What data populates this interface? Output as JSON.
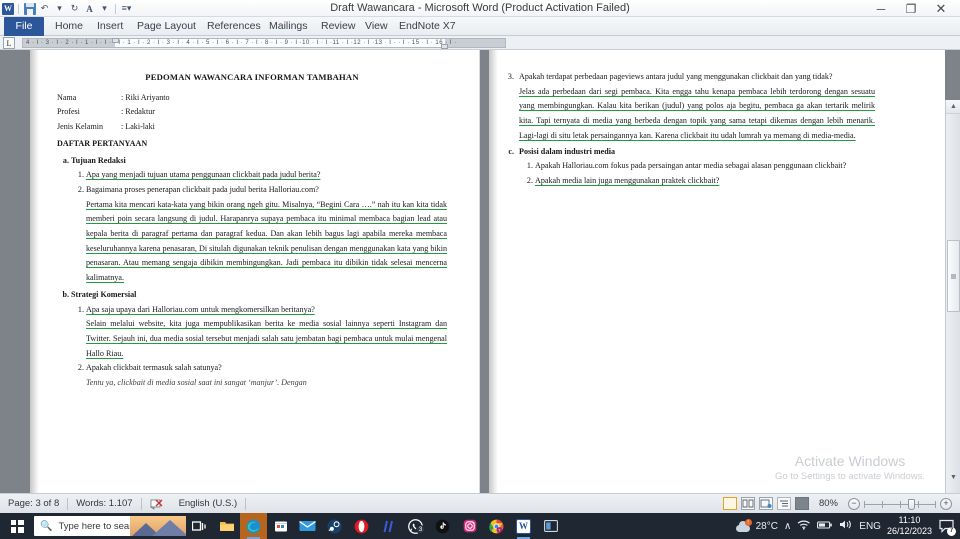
{
  "window": {
    "title": "Draft Wawancara  -  Microsoft Word (Product Activation Failed)",
    "minimize_label": "─",
    "restore_label": "❐",
    "close_label": "✕"
  },
  "quick_access": {
    "word_logo": "W",
    "items": [
      {
        "name": "save-icon",
        "label": "Save"
      },
      {
        "name": "undo-icon",
        "label": "↶"
      },
      {
        "name": "undo-dropdown-icon",
        "label": "▾"
      },
      {
        "name": "redo-icon",
        "label": "↻"
      },
      {
        "name": "font-color-icon",
        "label": "A"
      },
      {
        "name": "font-color-dropdown-icon",
        "label": "▾"
      },
      {
        "name": "customize-qat-icon",
        "label": "≡▾"
      }
    ]
  },
  "ribbon": {
    "tabs": [
      {
        "label": "File",
        "active": true
      },
      {
        "label": "Home",
        "active": false
      },
      {
        "label": "Insert",
        "active": false
      },
      {
        "label": "Page Layout",
        "active": false
      },
      {
        "label": "References",
        "active": false
      },
      {
        "label": "Mailings",
        "active": false
      },
      {
        "label": "Review",
        "active": false
      },
      {
        "label": "View",
        "active": false
      },
      {
        "label": "EndNote X7",
        "active": false
      }
    ],
    "ribbon_toggle_icon": "⌄",
    "help_icon": "?"
  },
  "ruler": {
    "tab_selector": "L",
    "marks": "4 · I · 3 · I · 2 · I · 1 · I · I · · I · 1 · I · 2 · I · 3 · I · 4 · I · 5 · I · 6 · I · 7 · I · 8 · I · 9 · I ·10 · I · I ·11 · I ·12 · I ·13 · I · · I · 15 · I · 16 · I ·"
  },
  "document": {
    "left_page": {
      "title": "PEDOMAN WAWANCARA INFORMAN TAMBAHAN",
      "meta": [
        {
          "key": "Nama",
          "value": ": Riki Ariyanto"
        },
        {
          "key": "Profesi",
          "value": ": Redaktur"
        },
        {
          "key": "Jenis Kelamin",
          "value": ": Laki-laki"
        }
      ],
      "section_heading": "DAFTAR PERTANYAAN",
      "sections": [
        {
          "label": "Tujuan Redaksi",
          "questions": [
            {
              "q": "Apa yang menjadi tujuan utama penggunaan clickbait pada judul berita?",
              "answer": ""
            },
            {
              "q": "Bagaimana proses penerapan clickbait pada judul berita Halloriau.com?",
              "answer": "Pertama kita mencari kata-kata yang bikin orang ngeh gitu. Misalnya, “Begini Cara ….” nah itu kan kita tidak memberi poin secara langsung di judul. Harapanrya supaya pembaca itu minimal membaca bagian lead atau kepala berita di paragraf pertama dan paragraf kedua. Dan akan lebih bagus lagi apabila mereka membaca keseluruhannya karena penasaran, Di situlah digunakan teknik penulisan dengan menggunakan kata yang bikin penasaran. Atau memang sengaja dibikin membingungkan. Jadi pembaca itu dibikin tidak selesai mencerna kalimatnya."
            }
          ]
        },
        {
          "label": "Strategi Komersial",
          "questions": [
            {
              "q": "Apa saja upaya dari Halloriau.com untuk mengkomersilkan beritanya?",
              "answer": "Selain melalui website, kita juga mempublikasikan berita ke media sosial lainnya seperti Instagram dan Twitter. Sejauh ini, dua media sosial tersebut menjadi salah satu jembatan bagi pembaca untuk mulai mengenal Hallo Riau."
            },
            {
              "q": "Apakah clickbait termasuk salah satunya?",
              "answer": "Tentu ya, clickbait di media sosial saat ini sangat ‘manjur’. Dengan"
            }
          ]
        }
      ]
    },
    "right_page": {
      "continued_question": {
        "number": "3.",
        "q": "Apakah terdapat perbedaan pageviews antara judul yang menggunakan clickbait dan yang tidak?",
        "answer": "Jelas ada perbedaan dari segi pembaca. Kita engga tahu kenapa pembaca lebih terdorong dengan sesuatu yang membingungkan. Kalau kita berikan (judul) yang polos aja begitu, pembaca ga akan tertarik melirik kita. Tapi ternyata di media yang berbeda dengan topik yang sama tetapi dikemas dengan lebih menarik. Lagi-lagi di situ letak persaingannya kan. Karena clickbait itu udah lumrah ya memang di media-media."
      },
      "section": {
        "label": "Posisi dalam industri media",
        "bullet": "c.",
        "questions": [
          "Apakah Halloriau.com fokus pada persaingan antar media sebagai alasan penggunaan clickbait?",
          "Apakah media lain juga menggunakan praktek clickbait?"
        ]
      }
    },
    "watermark": {
      "line1": "Activate Windows",
      "line2": "Go to Settings to activate Windows."
    }
  },
  "status_bar": {
    "page": "Page: 3 of 8",
    "words": "Words: 1.107",
    "proofing_icon": "proofing-errors-icon",
    "language": "English (U.S.)",
    "view_buttons": [
      {
        "name": "print-layout-view",
        "active": true
      },
      {
        "name": "full-screen-reading-view",
        "active": false
      },
      {
        "name": "web-layout-view",
        "active": false
      },
      {
        "name": "outline-view",
        "active": false
      },
      {
        "name": "draft-view",
        "active": false
      }
    ],
    "zoom_level": "80%",
    "zoom_out": "−",
    "zoom_in": "+"
  },
  "taskbar": {
    "start_icon": "windows-start-icon",
    "search_placeholder": "Type here to search",
    "pinned": [
      {
        "name": "task-view-icon",
        "glyph": "▣",
        "color": "#ffffff"
      },
      {
        "name": "file-explorer-icon",
        "glyph": "",
        "color": "#f5bc42"
      },
      {
        "name": "microsoft-edge-icon",
        "glyph": "",
        "color": "#1b8fd1"
      },
      {
        "name": "microsoft-store-icon",
        "glyph": "",
        "color": "#ffffff"
      },
      {
        "name": "mail-icon",
        "glyph": "✉",
        "color": "#2f9ae0"
      },
      {
        "name": "steam-icon",
        "glyph": "",
        "color": "#1b2838"
      },
      {
        "name": "opera-icon",
        "glyph": "O",
        "color": "#e11b22"
      },
      {
        "name": "hashtag-app-icon",
        "glyph": "//",
        "color": "#3b5bdb"
      },
      {
        "name": "whatsapp-icon",
        "glyph": "",
        "color": "#25d366",
        "badge": "3"
      },
      {
        "name": "tiktok-icon",
        "glyph": "♪",
        "color": "#111111"
      },
      {
        "name": "instagram-icon",
        "glyph": "",
        "color": "#d62976"
      },
      {
        "name": "chrome-icon",
        "glyph": "",
        "color": "#e8453c"
      },
      {
        "name": "word-taskbar-icon",
        "glyph": "W",
        "color": "#2b579a"
      },
      {
        "name": "media-app-icon",
        "glyph": "▤",
        "color": "#5b9bd5"
      }
    ],
    "weather": {
      "temp": "28°C",
      "icon": "cloud-weather-icon"
    },
    "tray": [
      {
        "name": "show-hidden-icons",
        "glyph": "∧"
      },
      {
        "name": "wifi-icon",
        "glyph": "◠"
      },
      {
        "name": "battery-icon",
        "glyph": "▭"
      },
      {
        "name": "volume-icon",
        "glyph": "◂))"
      },
      {
        "name": "language-indicator",
        "glyph": "ENG"
      }
    ],
    "clock": {
      "time": "11:10",
      "date": "26/12/2023"
    },
    "notification_count": "7"
  }
}
